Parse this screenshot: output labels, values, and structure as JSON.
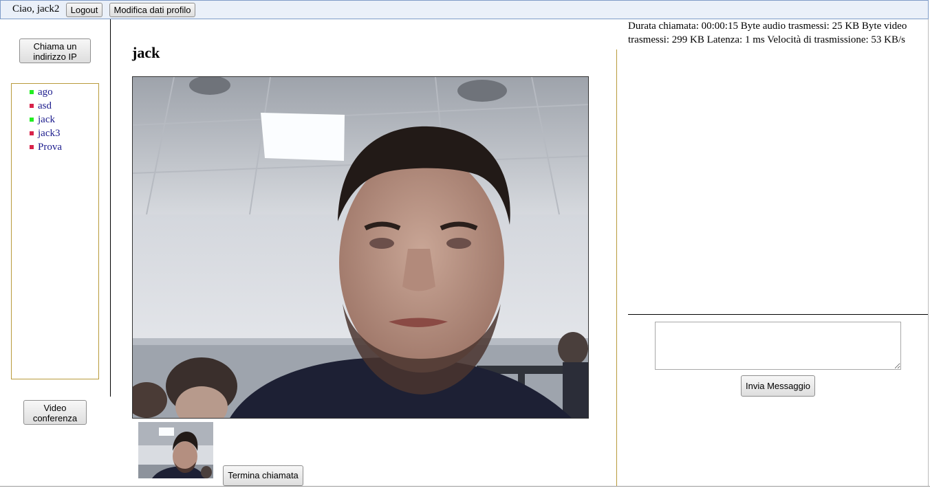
{
  "header": {
    "greeting": "Ciao, jack2",
    "logout_label": "Logout",
    "edit_profile_label": "Modifica dati profilo"
  },
  "sidebar": {
    "call_ip_label": "Chiama un indirizzo IP",
    "contacts": [
      {
        "name": "ago",
        "status": "online",
        "status_color": "#22ee22"
      },
      {
        "name": "asd",
        "status": "offline",
        "status_color": "#d8234a"
      },
      {
        "name": "jack",
        "status": "online",
        "status_color": "#22ee22"
      },
      {
        "name": "jack3",
        "status": "offline",
        "status_color": "#d8234a"
      },
      {
        "name": "Prova",
        "status": "offline",
        "status_color": "#d8234a"
      }
    ],
    "video_conference_label": "Video conferenza"
  },
  "call": {
    "callee_name": "jack",
    "end_call_label": "Termina chiamata"
  },
  "stats": {
    "text": "Durata chiamata: 00:00:15 Byte audio trasmessi: 25 KB Byte video trasmessi: 299 KB Latenza: 1 ms Velocità di trasmissione: 53 KB/s",
    "duration": "00:00:15",
    "audio_bytes": "25 KB",
    "video_bytes": "299 KB",
    "latency": "1 ms",
    "bitrate": "53 KB/s"
  },
  "chat": {
    "message_value": "",
    "send_label": "Invia Messaggio"
  },
  "colors": {
    "topbar_bg": "#eaf0f9",
    "panel_border": "#b89a3a",
    "contact_link": "#1a1a8c"
  }
}
